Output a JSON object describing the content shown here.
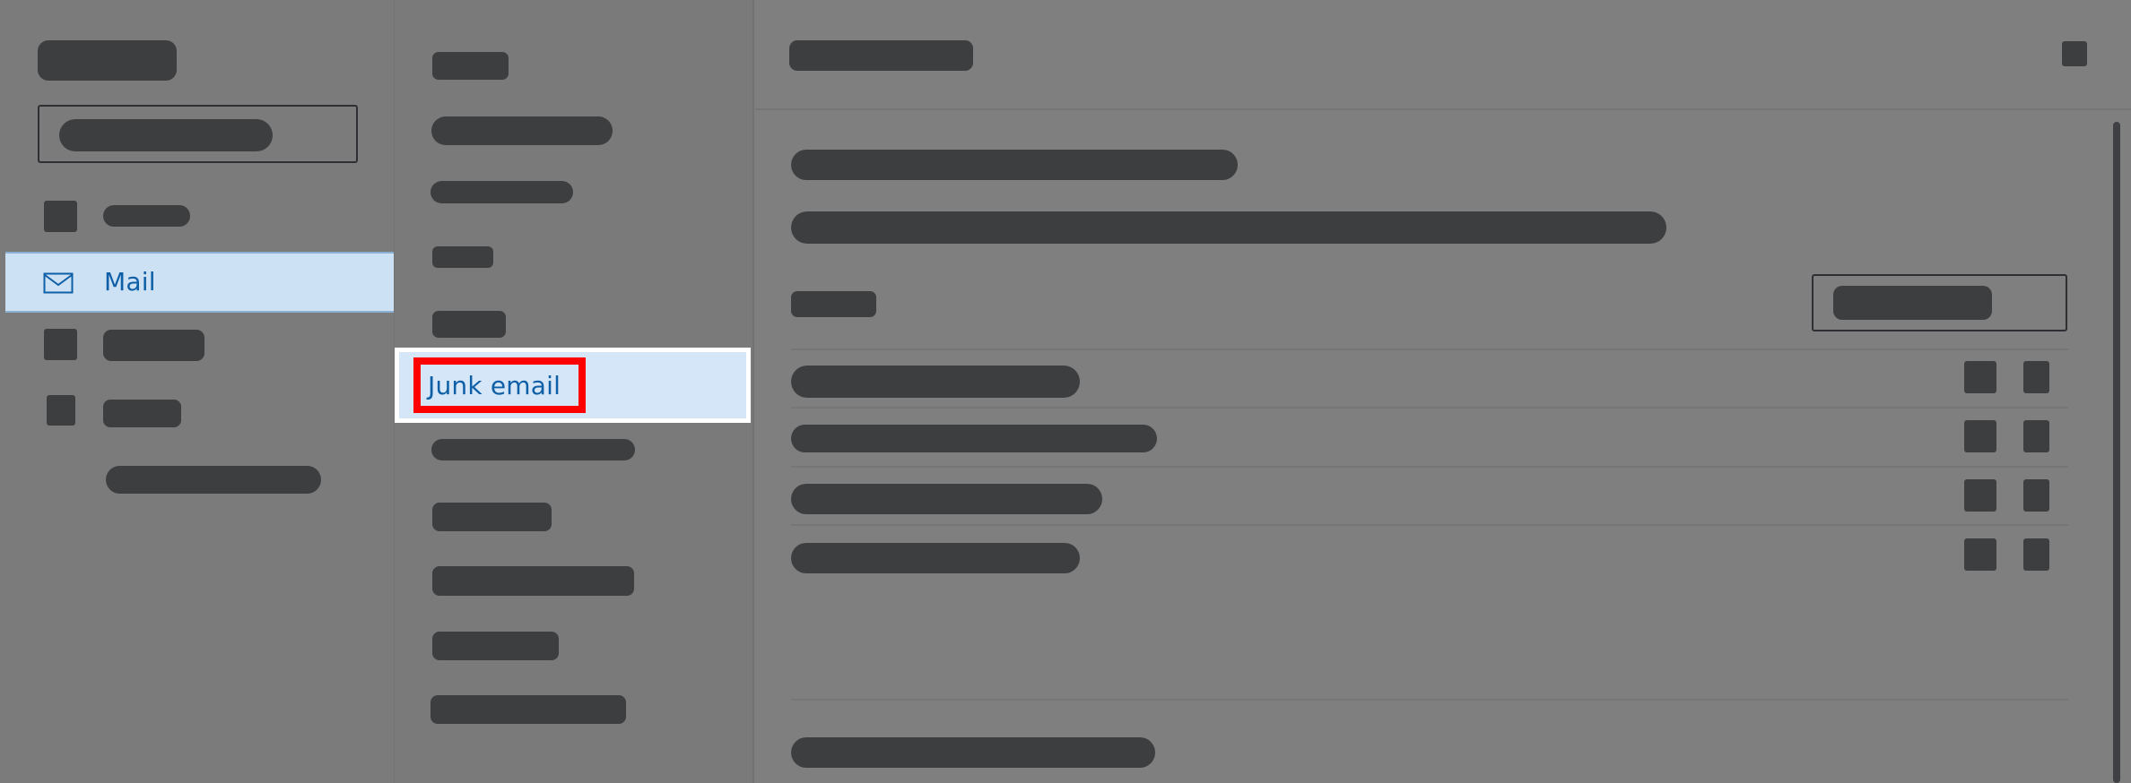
{
  "navigation": {
    "selected_label": "Mail"
  },
  "folders": {
    "selected_label": "Junk email"
  },
  "icons": {
    "mail": "mail-icon"
  },
  "colors": {
    "selection_background": "#cde1f4",
    "selection_text": "#0f5fa7",
    "highlight_border": "#ff0000"
  }
}
